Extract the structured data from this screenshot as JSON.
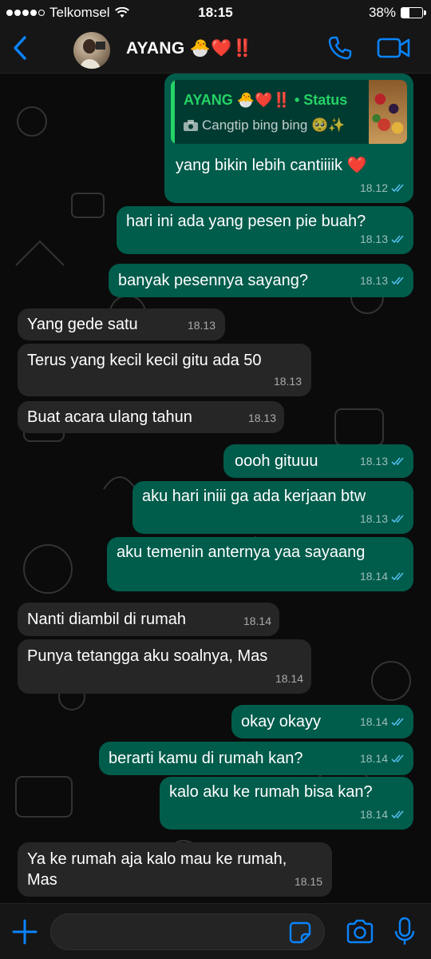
{
  "status_bar": {
    "carrier": "Telkomsel",
    "time": "18:15",
    "battery": "38%",
    "battery_level": 0.38
  },
  "header": {
    "contact_name": "AYANG 🐣❤️‼️"
  },
  "quoted_status": {
    "title": "AYANG 🐣❤️‼️ • Status",
    "text": "Cangtip bing bing 🥺✨"
  },
  "messages": [
    {
      "dir": "out",
      "text": "yang bikin lebih cantiiiik ❤️",
      "time": "18.12"
    },
    {
      "dir": "out",
      "text": "hari ini ada yang pesen pie buah?",
      "time": "18.13"
    },
    {
      "dir": "out",
      "text": "banyak pesennya sayang?",
      "time": "18.13"
    },
    {
      "dir": "in",
      "text": "Yang gede satu",
      "time": "18.13"
    },
    {
      "dir": "in",
      "text": "Terus yang kecil kecil gitu ada 50",
      "time": "18.13"
    },
    {
      "dir": "in",
      "text": "Buat acara ulang tahun",
      "time": "18.13"
    },
    {
      "dir": "out",
      "text": "oooh gituuu",
      "time": "18.13"
    },
    {
      "dir": "out",
      "text": "aku hari iniii ga ada kerjaan btw",
      "time": "18.13"
    },
    {
      "dir": "out",
      "text": "aku temenin anternya yaa sayaang",
      "time": "18.14"
    },
    {
      "dir": "in",
      "text": "Nanti diambil di rumah",
      "time": "18.14"
    },
    {
      "dir": "in",
      "text": "Punya tetangga aku soalnya, Mas",
      "time": "18.14"
    },
    {
      "dir": "out",
      "text": "okay okayy",
      "time": "18.14"
    },
    {
      "dir": "out",
      "text": "berarti kamu di rumah kan?",
      "time": "18.14"
    },
    {
      "dir": "out",
      "text": "kalo aku ke rumah bisa kan?",
      "time": "18.14"
    },
    {
      "dir": "in",
      "text": "Ya ke rumah aja kalo mau ke rumah,",
      "text2": "Mas",
      "time": "18.15"
    }
  ],
  "colors": {
    "accent": "#0a84ff",
    "outgoing": "#005c4b",
    "incoming": "#262626",
    "tick": "#53bdeb",
    "status_green": "#25d366"
  }
}
